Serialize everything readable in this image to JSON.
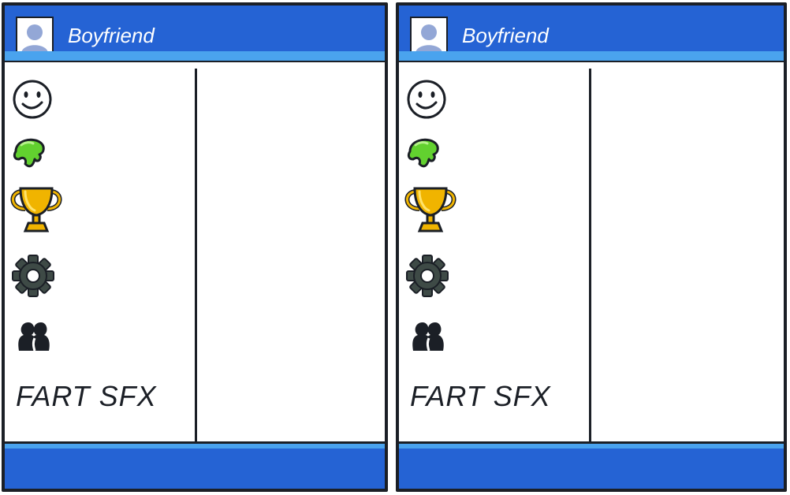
{
  "panels": [
    {
      "title": "Boyfriend",
      "menu": {
        "items": [
          {
            "icon": "smiley-face-icon"
          },
          {
            "icon": "green-leaf-icon"
          },
          {
            "icon": "trophy-icon"
          },
          {
            "icon": "gear-icon"
          },
          {
            "icon": "couple-silhouette-icon"
          }
        ],
        "fart_label": "FART SFX"
      }
    },
    {
      "title": "Boyfriend",
      "menu": {
        "items": [
          {
            "icon": "smiley-face-icon"
          },
          {
            "icon": "green-leaf-icon"
          },
          {
            "icon": "trophy-icon"
          },
          {
            "icon": "gear-icon"
          },
          {
            "icon": "couple-silhouette-icon"
          }
        ],
        "fart_label": "FART SFX"
      }
    }
  ],
  "colors": {
    "header_blue": "#2563d4",
    "header_stripe": "#4aa3ee",
    "outline": "#1b1f26",
    "leaf_green": "#62d12f",
    "trophy_gold": "#f0b400",
    "gear_gray": "#3e4a46"
  }
}
